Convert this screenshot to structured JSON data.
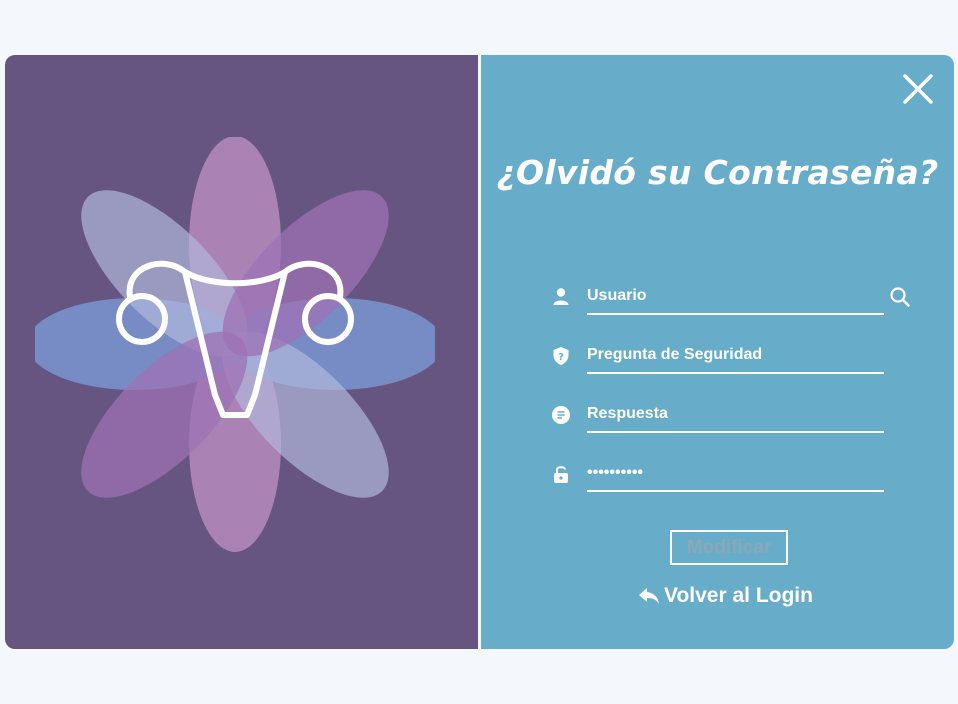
{
  "window": {
    "title": "¿Olvidó su Contraseña?",
    "close_icon": "close-icon"
  },
  "colors": {
    "left_panel": "#665580",
    "right_panel": "#67adca",
    "page_background": "#f4f7fb",
    "text": "#ffffff"
  },
  "logo": {
    "icon": "uterus-flower-logo"
  },
  "form": {
    "usuario": {
      "placeholder": "Usuario",
      "value": "",
      "icon": "user-icon",
      "action_icon": "search-icon"
    },
    "pregunta": {
      "placeholder": "Pregunta de Seguridad",
      "value": "",
      "icon": "shield-question-icon"
    },
    "respuesta": {
      "placeholder": "Respuesta",
      "value": "",
      "icon": "document-icon"
    },
    "password": {
      "value": "••••••••••",
      "icon": "lock-icon"
    }
  },
  "actions": {
    "modify_label": "Modificar",
    "back_label": "Volver al Login",
    "back_icon": "reply-arrow-icon"
  }
}
